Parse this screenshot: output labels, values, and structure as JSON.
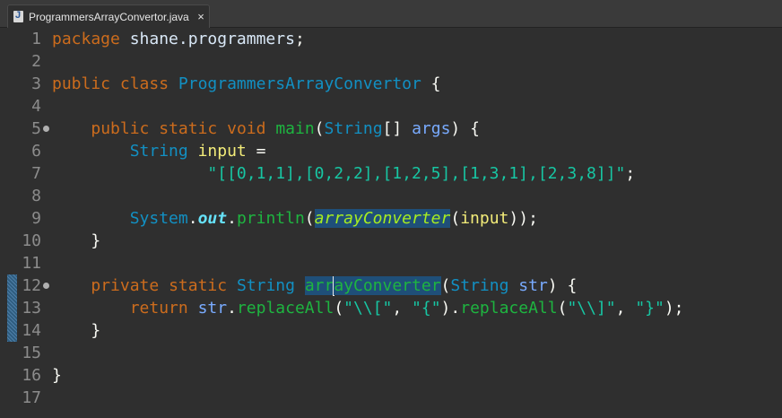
{
  "tab": {
    "icon": "java-file-icon",
    "title": "ProgrammersArrayConvertor.java",
    "close": "×"
  },
  "lines": [
    {
      "n": "1",
      "t": [
        [
          "package",
          "kw"
        ],
        [
          " ",
          "pun"
        ],
        [
          "shane.programmers",
          "pkg"
        ],
        [
          ";",
          "pun"
        ]
      ]
    },
    {
      "n": "2",
      "t": []
    },
    {
      "n": "3",
      "t": [
        [
          "public",
          "kw"
        ],
        [
          " ",
          "pun"
        ],
        [
          "class",
          "kw"
        ],
        [
          " ",
          "pun"
        ],
        [
          "ProgrammersArrayConvertor",
          "cls"
        ],
        [
          " {",
          "pun"
        ]
      ]
    },
    {
      "n": "4",
      "t": []
    },
    {
      "n": "5",
      "fold": true,
      "t": [
        [
          "    ",
          "pun"
        ],
        [
          "public",
          "kw"
        ],
        [
          " ",
          "pun"
        ],
        [
          "static",
          "kw"
        ],
        [
          " ",
          "pun"
        ],
        [
          "void",
          "kw"
        ],
        [
          " ",
          "pun"
        ],
        [
          "main",
          "mdecl"
        ],
        [
          "(",
          "pun"
        ],
        [
          "String",
          "type"
        ],
        [
          "[] ",
          "pun"
        ],
        [
          "args",
          "param"
        ],
        [
          ") {",
          "pun"
        ]
      ]
    },
    {
      "n": "6",
      "t": [
        [
          "        ",
          "pun"
        ],
        [
          "String",
          "type"
        ],
        [
          " ",
          "pun"
        ],
        [
          "input",
          "var"
        ],
        [
          " =",
          "pun"
        ]
      ]
    },
    {
      "n": "7",
      "t": [
        [
          "                ",
          "pun"
        ],
        [
          "\"[[0,1,1],[0,2,2],[1,2,5],[1,3,1],[2,3,8]]\"",
          "str"
        ],
        [
          ";",
          "pun"
        ]
      ]
    },
    {
      "n": "8",
      "t": []
    },
    {
      "n": "9",
      "t": [
        [
          "        ",
          "pun"
        ],
        [
          "System",
          "cls"
        ],
        [
          ".",
          "pun"
        ],
        [
          "out",
          "fld"
        ],
        [
          ".",
          "pun"
        ],
        [
          "println",
          "mdecl"
        ],
        [
          "(",
          "pun"
        ],
        [
          "arrayConverter",
          "mcall hl"
        ],
        [
          "(",
          "pun"
        ],
        [
          "input",
          "var"
        ],
        [
          "));",
          "pun"
        ]
      ]
    },
    {
      "n": "10",
      "t": [
        [
          "    }",
          "pun"
        ]
      ]
    },
    {
      "n": "11",
      "t": []
    },
    {
      "n": "12",
      "fold": true,
      "t": [
        [
          "    ",
          "pun"
        ],
        [
          "private",
          "kw"
        ],
        [
          " ",
          "pun"
        ],
        [
          "static",
          "kw"
        ],
        [
          " ",
          "pun"
        ],
        [
          "String",
          "type"
        ],
        [
          " ",
          "pun"
        ],
        [
          "arr",
          "mdecl hl2"
        ],
        [
          "|",
          "cursor"
        ],
        [
          "ayConverter",
          "mdecl hl2"
        ],
        [
          "(",
          "pun"
        ],
        [
          "String",
          "type"
        ],
        [
          " ",
          "pun"
        ],
        [
          "str",
          "param"
        ],
        [
          ") {",
          "pun"
        ]
      ]
    },
    {
      "n": "13",
      "t": [
        [
          "        ",
          "pun"
        ],
        [
          "return",
          "kw"
        ],
        [
          " ",
          "pun"
        ],
        [
          "str",
          "param"
        ],
        [
          ".",
          "pun"
        ],
        [
          "replaceAll",
          "mdecl"
        ],
        [
          "(",
          "pun"
        ],
        [
          "\"\\\\[\"",
          "str"
        ],
        [
          ", ",
          "pun"
        ],
        [
          "\"{\"",
          "str"
        ],
        [
          ").",
          "pun"
        ],
        [
          "replaceAll",
          "mdecl"
        ],
        [
          "(",
          "pun"
        ],
        [
          "\"\\\\]\"",
          "str"
        ],
        [
          ", ",
          "pun"
        ],
        [
          "\"}\"",
          "str"
        ],
        [
          ");",
          "pun"
        ]
      ]
    },
    {
      "n": "14",
      "t": [
        [
          "    }",
          "pun"
        ]
      ]
    },
    {
      "n": "15",
      "t": []
    },
    {
      "n": "16",
      "t": [
        [
          "}",
          "pun"
        ]
      ]
    },
    {
      "n": "17",
      "t": []
    }
  ]
}
